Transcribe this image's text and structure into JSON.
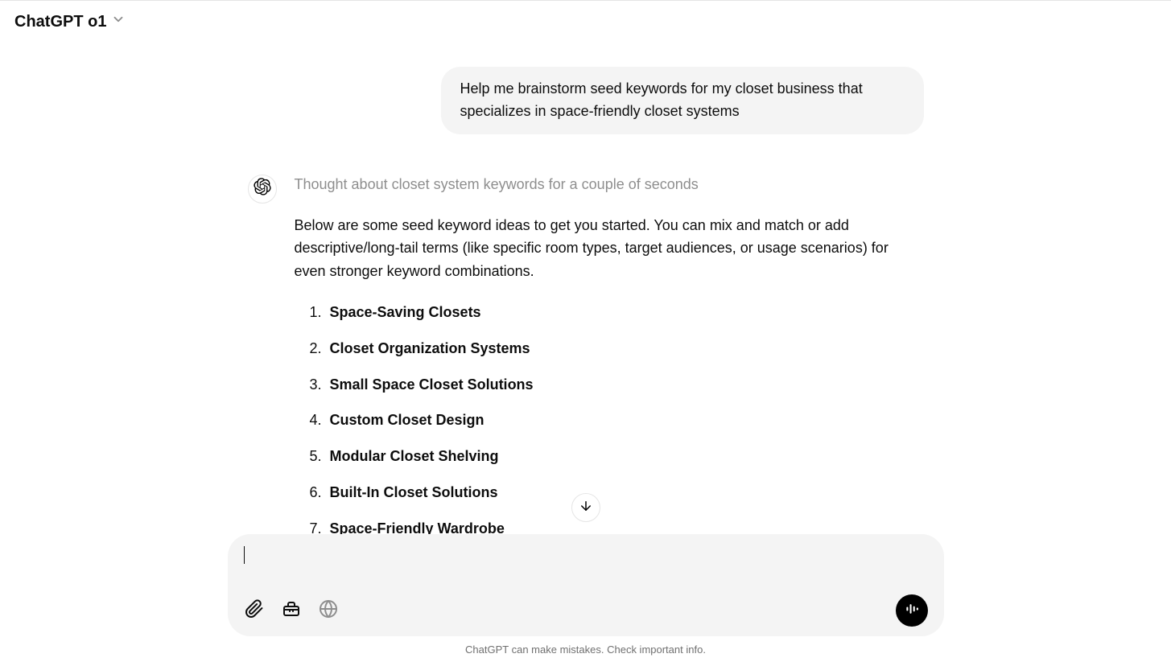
{
  "header": {
    "model_name": "ChatGPT o1"
  },
  "conversation": {
    "user_message": "Help me brainstorm seed keywords for my closet business that specializes in space-friendly closet systems",
    "assistant": {
      "thought": "Thought about closet system keywords for a couple of seconds",
      "intro": "Below are some seed keyword ideas to get you started. You can mix and match or add descriptive/long-tail terms (like specific room types, target audiences, or usage scenarios) for even stronger keyword combinations.",
      "keywords": [
        "Space-Saving Closets",
        "Closet Organization Systems",
        "Small Space Closet Solutions",
        "Custom Closet Design",
        "Modular Closet Shelving",
        "Built-In Closet Solutions",
        "Space-Friendly Wardrobe"
      ]
    }
  },
  "composer": {
    "placeholder": ""
  },
  "footer": {
    "disclaimer": "ChatGPT can make mistakes. Check important info."
  }
}
